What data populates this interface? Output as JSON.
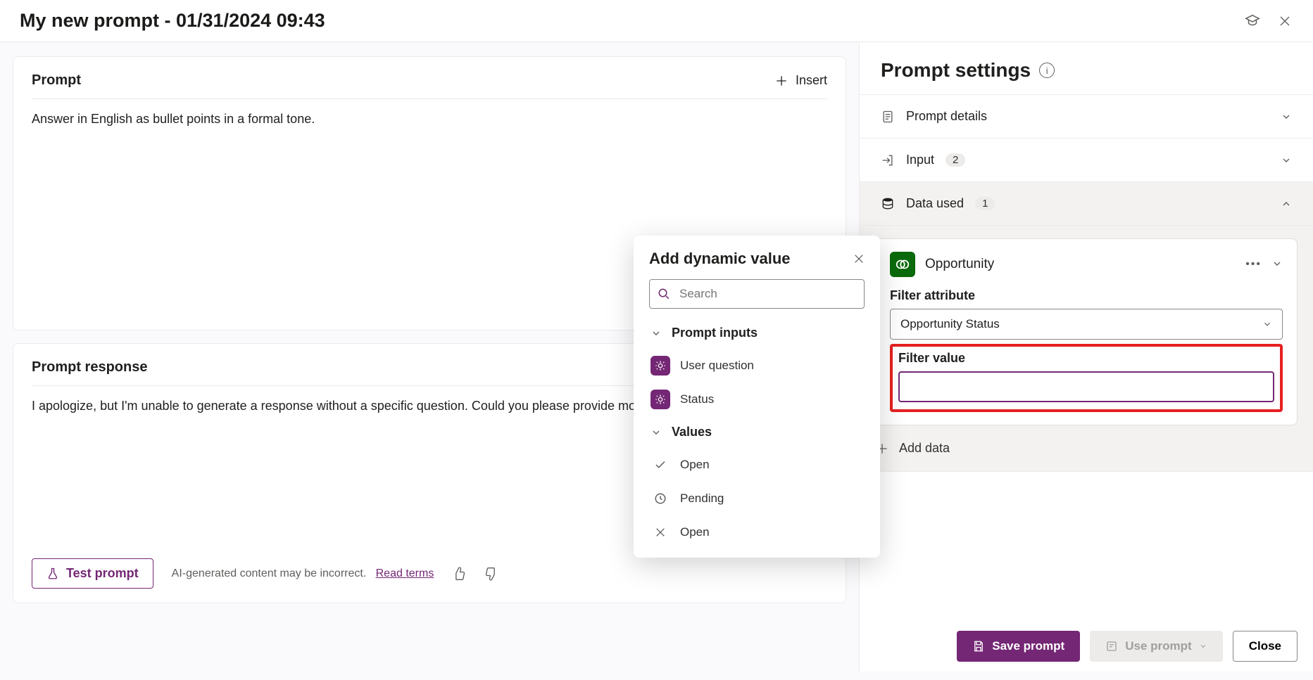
{
  "header": {
    "title": "My new prompt - 01/31/2024 09:43"
  },
  "prompt": {
    "section_label": "Prompt",
    "insert_label": "Insert",
    "text": "Answer in English as bullet points in a formal tone."
  },
  "response": {
    "section_label": "Prompt response",
    "text": "I apologize, but I'm unable to generate a response without a specific question. Could you please provide more de",
    "test_label": "Test prompt",
    "ai_note": "AI-generated content may be incorrect.",
    "read_terms": "Read terms"
  },
  "popup": {
    "title": "Add dynamic value",
    "search_placeholder": "Search",
    "sections": {
      "inputs_label": "Prompt inputs",
      "values_label": "Values"
    },
    "inputs": [
      {
        "label": "User question"
      },
      {
        "label": "Status"
      }
    ],
    "values": [
      {
        "icon": "check",
        "label": "Open"
      },
      {
        "icon": "pending",
        "label": "Pending"
      },
      {
        "icon": "close",
        "label": "Open"
      }
    ]
  },
  "settings": {
    "title": "Prompt settings",
    "details_label": "Prompt details",
    "input_label": "Input",
    "input_count": "2",
    "data_used_label": "Data used",
    "data_used_count": "1",
    "opportunity": {
      "name": "Opportunity",
      "filter_attr_label": "Filter attribute",
      "filter_attr_value": "Opportunity Status",
      "filter_value_label": "Filter value",
      "filter_value_value": ""
    },
    "add_data_label": "Add data"
  },
  "footer": {
    "save_label": "Save prompt",
    "use_label": "Use prompt",
    "close_label": "Close"
  }
}
